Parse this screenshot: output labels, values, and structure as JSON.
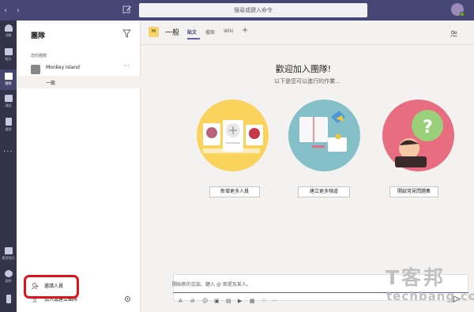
{
  "topbar": {
    "search_placeholder": "搜尋或鍵入命令"
  },
  "rail": {
    "items": [
      {
        "label": "活動",
        "icon": "bell-icon"
      },
      {
        "label": "聊天",
        "icon": "chat-icon"
      },
      {
        "label": "團隊",
        "icon": "teams-icon"
      },
      {
        "label": "通話",
        "icon": "phone-icon"
      },
      {
        "label": "檔案",
        "icon": "file-icon"
      }
    ],
    "more": "...",
    "bottom": [
      {
        "label": "應用程式",
        "icon": "apps-icon"
      },
      {
        "label": "說明",
        "icon": "help-icon"
      }
    ]
  },
  "panel": {
    "title": "團隊",
    "section_label": "您的團隊",
    "team_name": "Monkey Island",
    "channel_name": "一般",
    "invite_label": "邀請人員",
    "join_label": "加入或建立團隊",
    "more_label": "···"
  },
  "channel": {
    "team_badge": "MI",
    "title": "一般",
    "tabs": [
      "貼文",
      "檔案",
      "Wiki"
    ],
    "active_tab": "貼文",
    "add_tab": "+"
  },
  "welcome": {
    "title": "歡迎加入團隊!",
    "subtitle": "以下是您可以進行的作業...",
    "actions": [
      "新增更多人員",
      "建立更多頻道",
      "開啟常見問題集"
    ]
  },
  "composer": {
    "placeholder": "開始新的交談。鍵入 @ 來提及某人。",
    "more": "···"
  },
  "watermark": {
    "line1": "T客邦",
    "line2": "techbang.com"
  },
  "colors": {
    "topbar": "#464775",
    "rail": "#33344a",
    "accent": "#6264a7",
    "highlight": "#e0121a"
  }
}
